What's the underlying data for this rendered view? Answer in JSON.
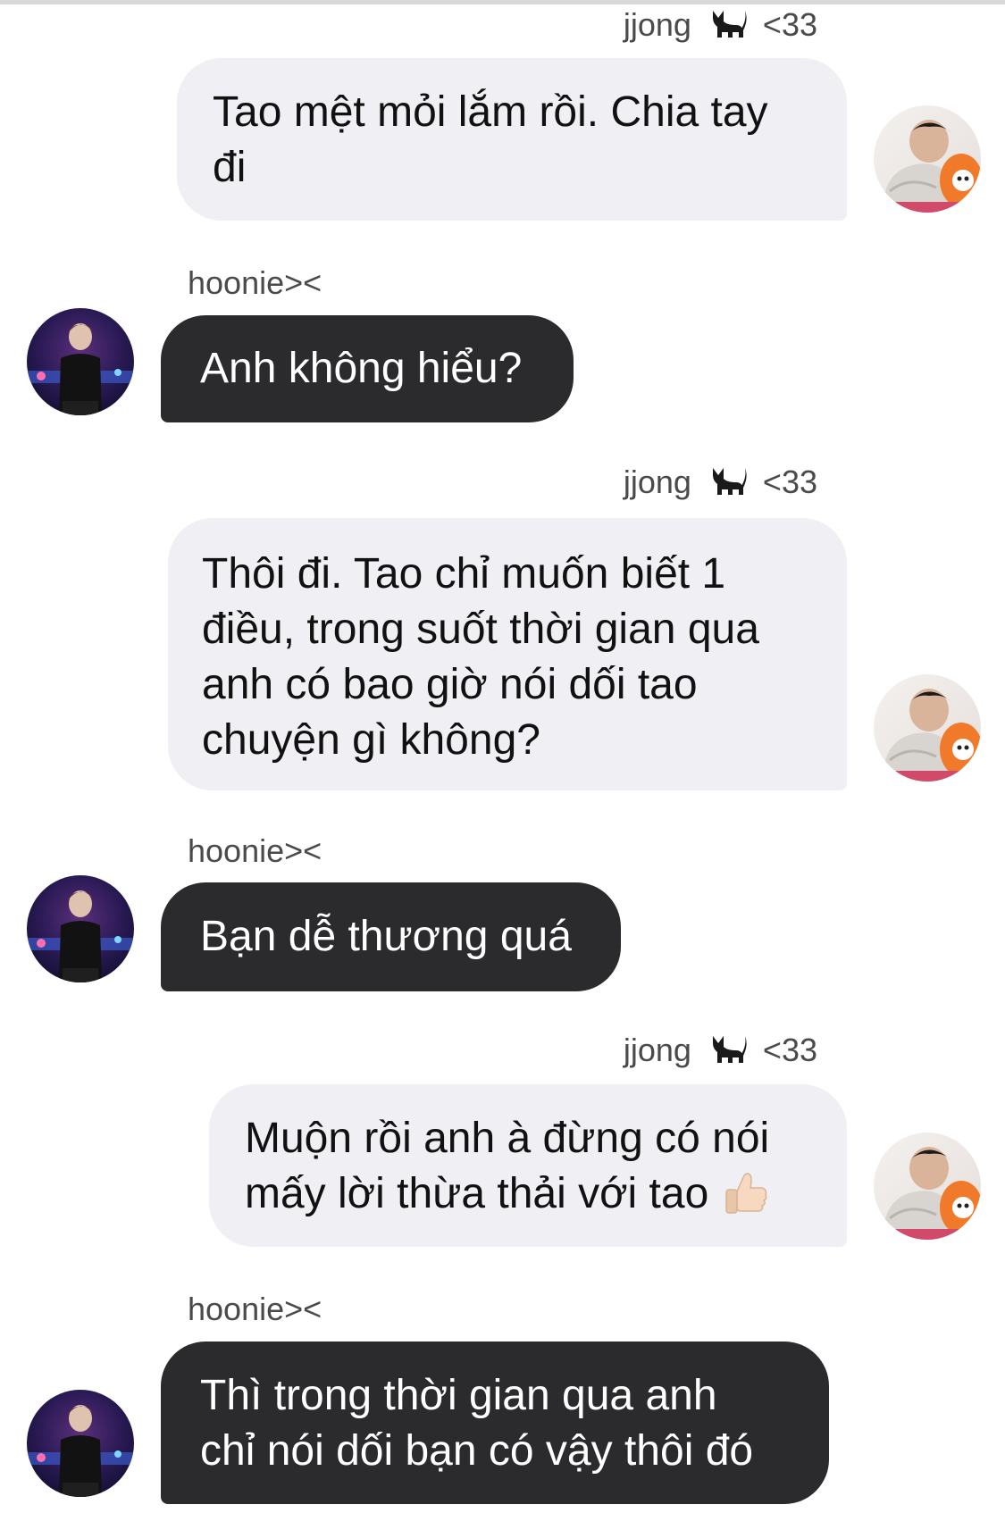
{
  "conversation": {
    "participants": {
      "me": {
        "name": "jjong",
        "name_suffix": "<33",
        "name_icon": "black-cat-icon"
      },
      "them": {
        "name": "hoonie><"
      }
    },
    "messages": [
      {
        "from": "me",
        "lines": [
          "Tao mệt mỏi lắm rồi. Chia tay",
          "đi"
        ]
      },
      {
        "from": "them",
        "lines": [
          "Anh không hiểu?"
        ]
      },
      {
        "from": "me",
        "lines": [
          "Thôi đi. Tao chỉ muốn biết 1",
          "điều, trong suốt thời gian qua",
          "anh có bao giờ nói dối tao",
          "chuyện gì không?"
        ]
      },
      {
        "from": "them",
        "lines": [
          "Bạn dễ thương quá"
        ]
      },
      {
        "from": "me",
        "lines": [
          "Muộn rồi anh à đừng có nói",
          "mấy lời thừa thải với tao"
        ],
        "trailing_emoji": "thumbs-up-icon"
      },
      {
        "from": "them",
        "lines": [
          "Thì trong thời gian qua anh",
          "chỉ nói dối bạn có vậy thôi đó"
        ]
      }
    ]
  },
  "colors": {
    "outgoing_bubble": "#efeff4",
    "incoming_bubble": "#2b2b2d",
    "incoming_text": "#ffffff",
    "sender_label": "#4a4a4a"
  }
}
